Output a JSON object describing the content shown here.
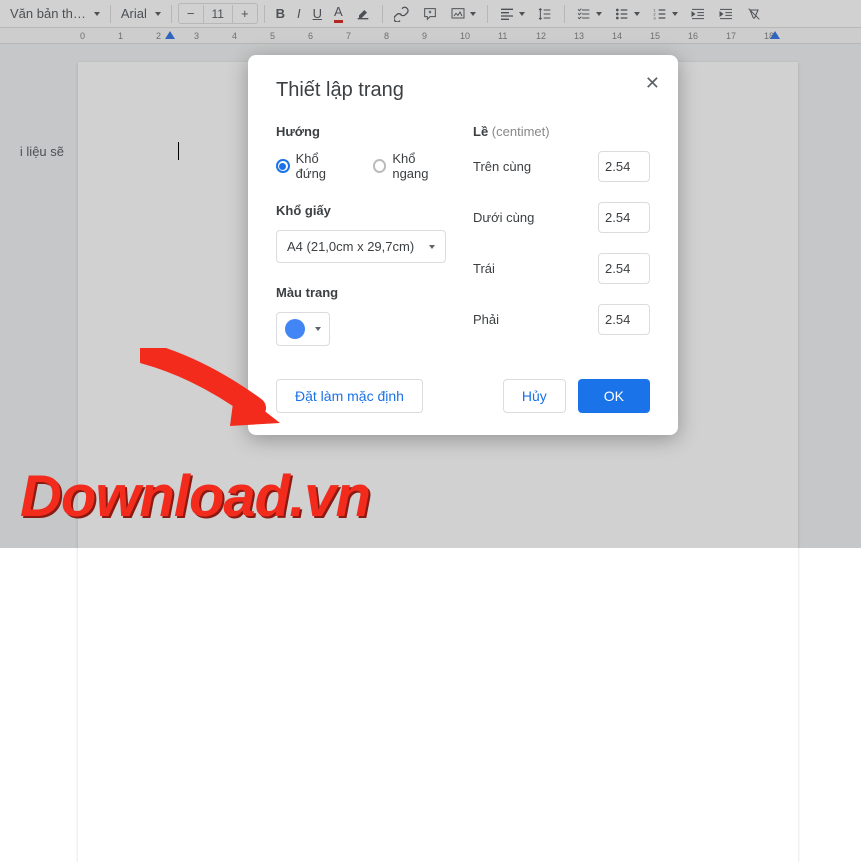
{
  "toolbar": {
    "style_dd": "Văn bản th…",
    "font_dd": "Arial",
    "font_size": "11"
  },
  "ruler": {
    "marks": [
      "0",
      "1",
      "2",
      "3",
      "4",
      "5",
      "6",
      "7",
      "8",
      "9",
      "10",
      "11",
      "12",
      "13",
      "14",
      "15",
      "16",
      "17",
      "18"
    ]
  },
  "sidebar": {
    "text": "i liệu sẽ"
  },
  "dialog": {
    "title": "Thiết lập trang",
    "orientation": {
      "label": "Hướng",
      "portrait": "Khổ đứng",
      "landscape": "Khổ ngang"
    },
    "paper": {
      "label": "Khổ giấy",
      "value": "A4 (21,0cm x 29,7cm)"
    },
    "color": {
      "label": "Màu trang"
    },
    "margins": {
      "label": "Lề",
      "unit": "(centimet)",
      "top_label": "Trên cùng",
      "top": "2.54",
      "bottom_label": "Dưới cùng",
      "bottom": "2.54",
      "left_label": "Trái",
      "left": "2.54",
      "right_label": "Phải",
      "right": "2.54"
    },
    "buttons": {
      "default": "Đặt làm mặc định",
      "cancel": "Hủy",
      "ok": "OK"
    }
  },
  "watermark": "Download.vn"
}
